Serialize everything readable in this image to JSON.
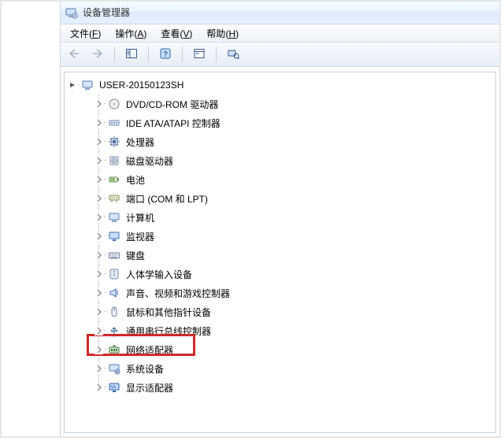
{
  "window": {
    "title": "设备管理器"
  },
  "menu": {
    "file": {
      "label": "文件",
      "accel": "F"
    },
    "action": {
      "label": "操作",
      "accel": "A"
    },
    "view": {
      "label": "查看",
      "accel": "V"
    },
    "help": {
      "label": "帮助",
      "accel": "H"
    }
  },
  "toolbar": {
    "back": "back-icon",
    "forward": "forward-icon",
    "up": "show-hide-tree-icon",
    "help": "help-icon",
    "properties": "properties-icon",
    "scan": "scan-hardware-icon"
  },
  "tree": {
    "root": {
      "label": "USER-20150123SH",
      "expanded": true
    },
    "children": [
      {
        "id": "dvd",
        "label": "DVD/CD-ROM 驱动器",
        "icon": "disc"
      },
      {
        "id": "ide",
        "label": "IDE ATA/ATAPI 控制器",
        "icon": "ide"
      },
      {
        "id": "cpu",
        "label": "处理器",
        "icon": "cpu"
      },
      {
        "id": "disk",
        "label": "磁盘驱动器",
        "icon": "disk"
      },
      {
        "id": "battery",
        "label": "电池",
        "icon": "battery"
      },
      {
        "id": "ports",
        "label": "端口 (COM 和 LPT)",
        "icon": "port"
      },
      {
        "id": "computer",
        "label": "计算机",
        "icon": "computer"
      },
      {
        "id": "monitor",
        "label": "监视器",
        "icon": "monitor"
      },
      {
        "id": "keyboard",
        "label": "键盘",
        "icon": "keyboard"
      },
      {
        "id": "hid",
        "label": "人体学输入设备",
        "icon": "hid"
      },
      {
        "id": "sound",
        "label": "声音、视频和游戏控制器",
        "icon": "sound"
      },
      {
        "id": "mouse",
        "label": "鼠标和其他指针设备",
        "icon": "mouse"
      },
      {
        "id": "usb",
        "label": "通用串行总线控制器",
        "icon": "usb"
      },
      {
        "id": "network",
        "label": "网络适配器",
        "icon": "network",
        "highlighted": true
      },
      {
        "id": "system",
        "label": "系统设备",
        "icon": "system"
      },
      {
        "id": "display",
        "label": "显示适配器",
        "icon": "display"
      }
    ]
  }
}
